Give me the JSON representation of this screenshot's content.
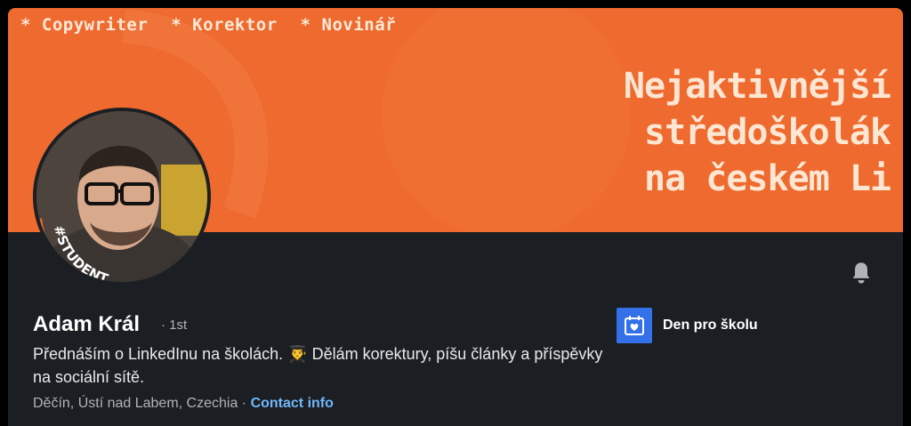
{
  "banner": {
    "tags": [
      "* Copywriter",
      "* Korektor",
      "* Novinář"
    ],
    "headline_lines": [
      "Nejaktivnější",
      "středoškolák",
      "na českém Li"
    ]
  },
  "avatar": {
    "frame_text": "#STUDENT"
  },
  "profile": {
    "name": "Adam Král",
    "degree": "· 1st",
    "headline": "Přednáším o LinkedInu na školách. 👨‍🎓 Dělám korektury, píšu články a příspěvky na sociální sítě.",
    "location": "Děčín, Ústí nad Labem, Czechia",
    "separator": " · ",
    "contact_label": "Contact info"
  },
  "experience": {
    "company": "Den pro školu"
  },
  "colors": {
    "banner": "#ee6a2f",
    "card_bg": "#1b1f23",
    "link": "#71b7fb",
    "company_logo": "#3471e8"
  },
  "icons": {
    "bell": "bell-icon",
    "company": "calendar-heart-icon"
  }
}
